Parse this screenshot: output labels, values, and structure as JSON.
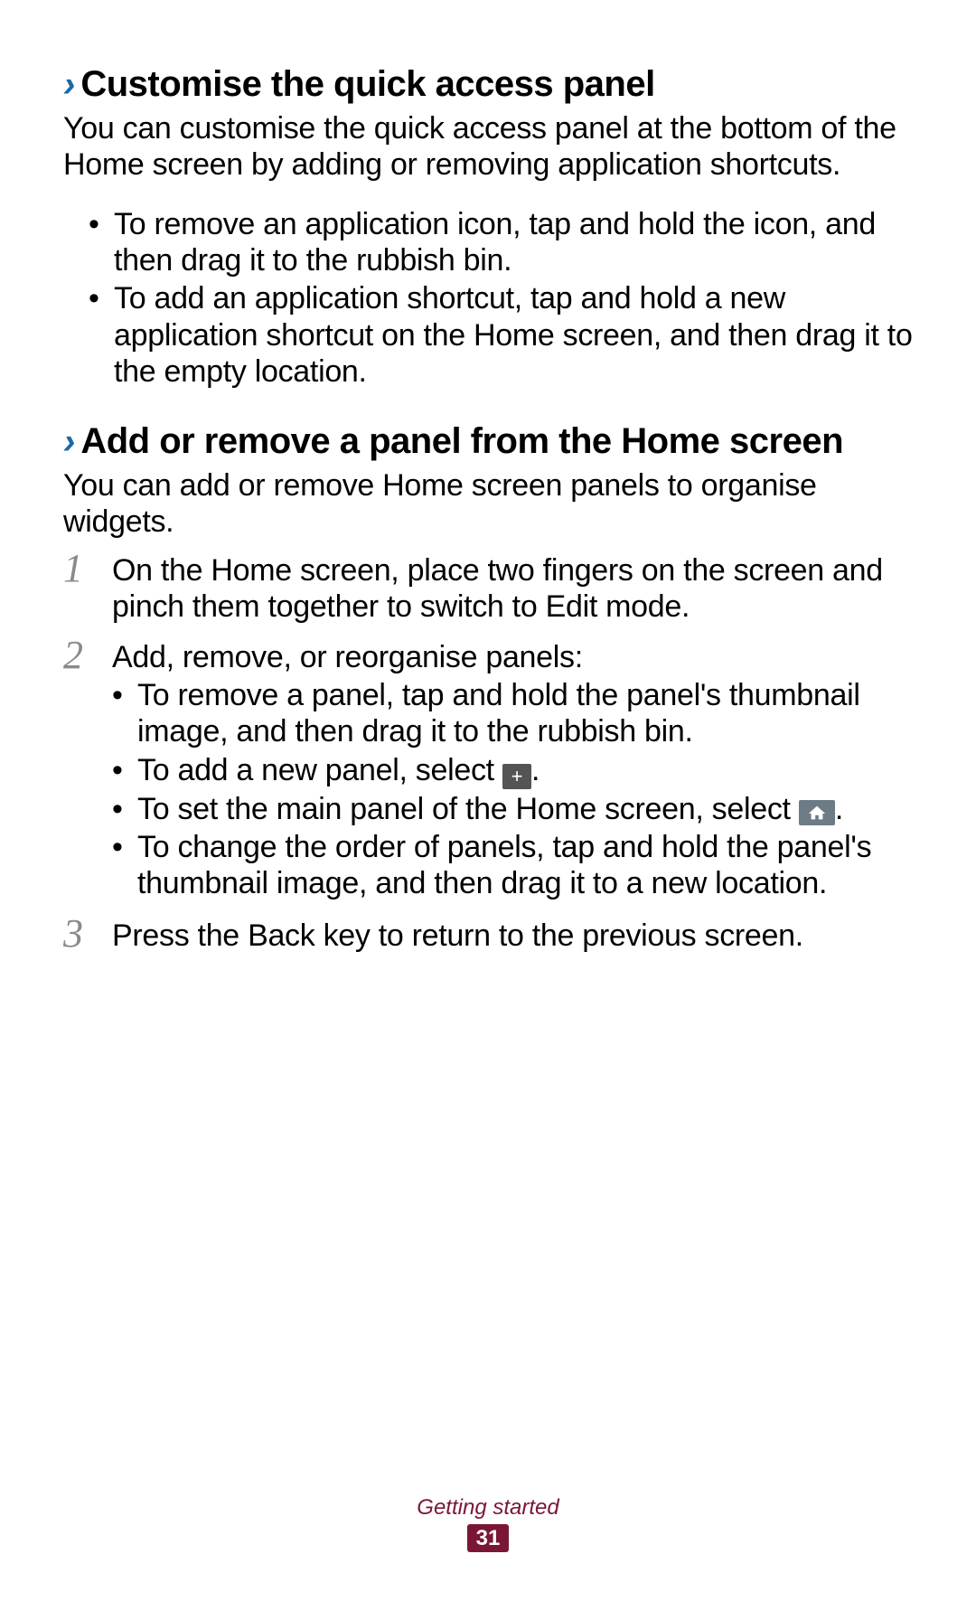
{
  "section1": {
    "heading": "Customise the quick access panel",
    "intro": "You can customise the quick access panel at the bottom of the Home screen by adding or removing application shortcuts.",
    "bullets": [
      "To remove an application icon, tap and hold the icon, and then drag it to the rubbish bin.",
      "To add an application shortcut, tap and hold a new application shortcut on the Home screen, and then drag it to the empty location."
    ]
  },
  "section2": {
    "heading": "Add or remove a panel from the Home screen",
    "intro": "You can add or remove Home screen panels to organise widgets.",
    "steps": {
      "s1": {
        "num": "1",
        "text": "On the Home screen, place two fingers on the screen and pinch them together to switch to Edit mode."
      },
      "s2": {
        "num": "2",
        "text": "Add, remove, or reorganise panels:",
        "sub": {
          "a": "To remove a panel, tap and hold the panel's thumbnail image, and then drag it to the rubbish bin.",
          "b_pre": "To add a new panel, select ",
          "b_post": ".",
          "c_pre": "To set the main panel of the Home screen, select ",
          "c_post": ".",
          "d": "To change the order of panels, tap and hold the panel's thumbnail image, and then drag it to a new location."
        }
      },
      "s3": {
        "num": "3",
        "text": "Press the Back key to return to the previous screen."
      }
    }
  },
  "footer": {
    "label": "Getting started",
    "page": "31"
  },
  "icons": {
    "plus": "+"
  }
}
